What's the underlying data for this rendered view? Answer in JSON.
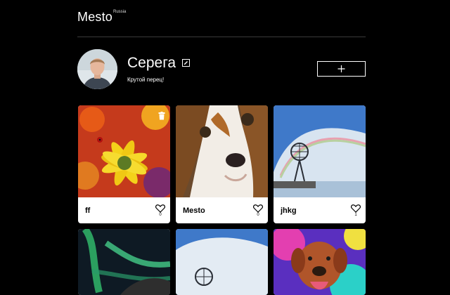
{
  "header": {
    "logo": "Mesto",
    "logo_sub": "Russia"
  },
  "profile": {
    "name": "Серега",
    "about": "Крутой перец!",
    "add_label": "+"
  },
  "cards": [
    {
      "title": "ff",
      "likes": "0",
      "image": "yellow-flower-ladybug"
    },
    {
      "title": "Mesto",
      "likes": "0",
      "image": "beagle-puppy"
    },
    {
      "title": "jhkg",
      "likes": "1",
      "image": "globe-monument-rainbow"
    },
    {
      "title": "",
      "likes": "",
      "image": "northern-lights"
    },
    {
      "title": "",
      "likes": "",
      "image": "globe-monument-clouds"
    },
    {
      "title": "",
      "likes": "",
      "image": "dog-psychedelic"
    }
  ],
  "icons": {
    "edit": "pencil-icon",
    "add": "plus-icon",
    "like": "heart-icon",
    "delete": "trash-icon"
  },
  "colors": {
    "background": "#000000",
    "card": "#ffffff",
    "text": "#ffffff"
  }
}
